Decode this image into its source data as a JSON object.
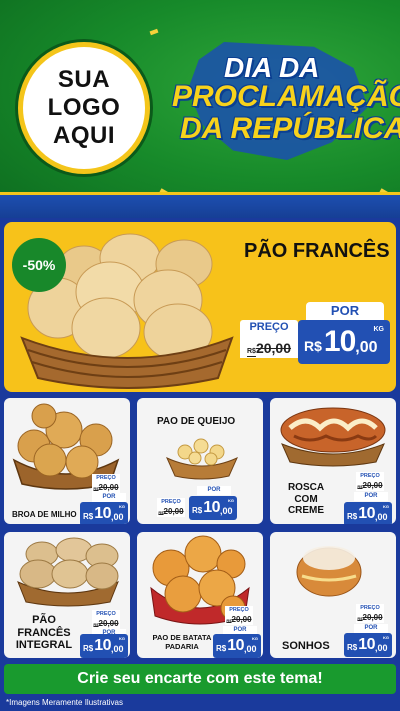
{
  "logo": {
    "line1": "SUA",
    "line2": "LOGO",
    "line3": "AQUI"
  },
  "title": {
    "line1": "DIA DA",
    "line2": "PROCLAMAÇÃO",
    "line3": "DA REPÚBLICA"
  },
  "featured": {
    "name": "PÃO FRANCÊS",
    "discount": "-50%",
    "por": "POR",
    "preco": "PREÇO",
    "old_currency": "R$",
    "old_price": "20,00",
    "currency": "R$",
    "price_int": "10",
    "price_cents": ",00",
    "unit": "KG"
  },
  "products": [
    {
      "name": "BROA DE MILHO",
      "preco": "PREÇO",
      "old_currency": "R$",
      "old_price": "20,00",
      "por": "POR",
      "currency": "R$",
      "price_int": "10",
      "price_cents": ",00",
      "unit": "KG"
    },
    {
      "name": "PAO DE QUEIJO",
      "preco": "PREÇO",
      "old_currency": "R$",
      "old_price": "20,00",
      "por": "POR",
      "currency": "R$",
      "price_int": "10",
      "price_cents": ",00",
      "unit": "KG"
    },
    {
      "name_l1": "ROSCA",
      "name_l2": "COM",
      "name_l3": "CREME",
      "preco": "PREÇO",
      "old_currency": "R$",
      "old_price": "20,00",
      "por": "POR",
      "currency": "R$",
      "price_int": "10",
      "price_cents": ",00",
      "unit": "KG"
    },
    {
      "name_l1": "PÃO",
      "name_l2": "FRANCÊS",
      "name_l3": "INTEGRAL",
      "preco": "PREÇO",
      "old_currency": "R$",
      "old_price": "20,00",
      "por": "POR",
      "currency": "R$",
      "price_int": "10",
      "price_cents": ",00",
      "unit": "KG"
    },
    {
      "name_l1": "PAO DE BATATA",
      "name_l2": "PADARIA",
      "preco": "PREÇO",
      "old_currency": "R$",
      "old_price": "20,00",
      "por": "POR",
      "currency": "R$",
      "price_int": "10",
      "price_cents": ",00",
      "unit": "KG"
    },
    {
      "name": "SONHOS",
      "preco": "PREÇO",
      "old_currency": "R$",
      "old_price": "20,00",
      "por": "POR",
      "currency": "R$",
      "price_int": "10",
      "price_cents": ",00",
      "unit": "KG"
    }
  ],
  "cta": "Crie seu encarte com este tema!",
  "footer": "*Imagens Meramente Ilustrativas",
  "colors": {
    "green": "#199a2e",
    "yellow": "#f7c21a",
    "blue": "#2250b3",
    "navy": "#1a3a9c"
  }
}
